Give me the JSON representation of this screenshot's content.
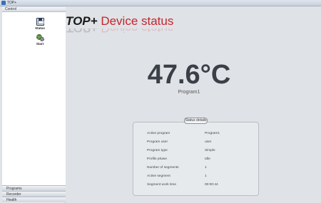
{
  "window": {
    "title": "TOP+"
  },
  "sidebar": {
    "header": "Control",
    "buttons": [
      {
        "label": "Status",
        "icon": "floppy-icon"
      },
      {
        "label": "Start",
        "icon": "gear-icon"
      }
    ],
    "nav": [
      "Programs",
      "Recorder",
      "Health"
    ]
  },
  "main": {
    "brand": "TOP+",
    "page_title": "Device status",
    "temperature": "47.6°C",
    "program": "Program1",
    "status_details": {
      "caption": "Status details",
      "rows": [
        {
          "label": "Active program",
          "value": "Program1"
        },
        {
          "label": "Program user",
          "value": "user"
        },
        {
          "label": "Program type",
          "value": "Simple"
        },
        {
          "label": "Profile phase",
          "value": "Idle"
        },
        {
          "label": "Number of segments",
          "value": "1"
        },
        {
          "label": "Active segment",
          "value": "1"
        },
        {
          "label": "Segment work time",
          "value": "00:00:44"
        }
      ]
    }
  },
  "colors": {
    "accent": "#c4262e",
    "text": "#3b4048"
  }
}
